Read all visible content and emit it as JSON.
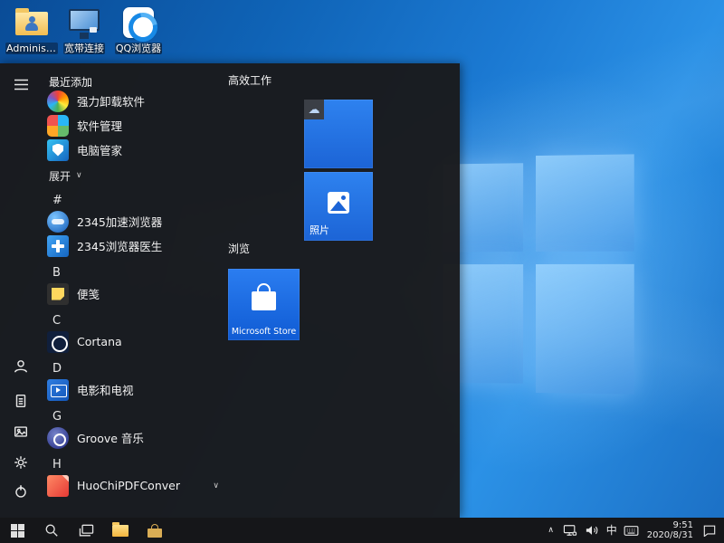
{
  "desktop": {
    "icons": [
      {
        "label": "Administra..."
      },
      {
        "label": "宽带连接"
      },
      {
        "label": "QQ浏览器"
      }
    ]
  },
  "start_menu": {
    "recent_header": "最近添加",
    "recent": [
      "强力卸载软件",
      "软件管理",
      "电脑管家"
    ],
    "expand_label": "展开",
    "sections": [
      {
        "letter": "#",
        "items": [
          "2345加速浏览器",
          "2345浏览器医生"
        ]
      },
      {
        "letter": "B",
        "items": [
          "便笺"
        ]
      },
      {
        "letter": "C",
        "items": [
          "Cortana"
        ]
      },
      {
        "letter": "D",
        "items": [
          "电影和电视"
        ]
      },
      {
        "letter": "G",
        "items": [
          "Groove 音乐"
        ]
      },
      {
        "letter": "H",
        "items": [
          "HuoChiPDFConver"
        ]
      }
    ],
    "tile_groups": [
      {
        "header": "高效工作"
      },
      {
        "header": "浏览"
      }
    ],
    "tiles": {
      "photos_label": "照片",
      "store_label": "Microsoft Store"
    }
  },
  "tray": {
    "time": "9:51",
    "date": "2020/8/31",
    "ime": "中"
  },
  "glyphs": {
    "cloud": "☁",
    "chevron_down": "∨",
    "chevron_up": "∧"
  },
  "colors": {
    "tile_blue": "#2170e8",
    "wallpaper_blue": "#1b79d2",
    "menu_dark": "#1a1a1c"
  }
}
